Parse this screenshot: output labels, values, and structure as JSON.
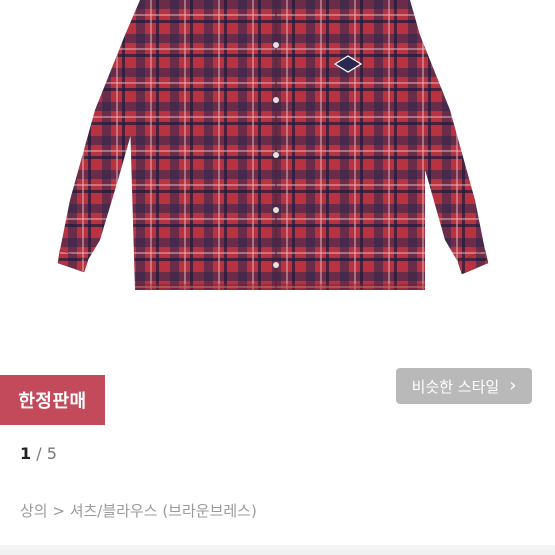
{
  "badge": {
    "label": "한정판매"
  },
  "similar_button": {
    "label": "비슷한 스타일",
    "icon": "chevron-right-icon"
  },
  "pager": {
    "current": "1",
    "separator": "/",
    "total": "5"
  },
  "breadcrumb": {
    "text": "상의 > 셔츠/블라우스 (브라운브레스)"
  },
  "colors": {
    "badge": "#c24a5a",
    "shirt_red": "#b8323f",
    "shirt_navy": "#2a2750",
    "button_gray": "#b9b9b9"
  }
}
